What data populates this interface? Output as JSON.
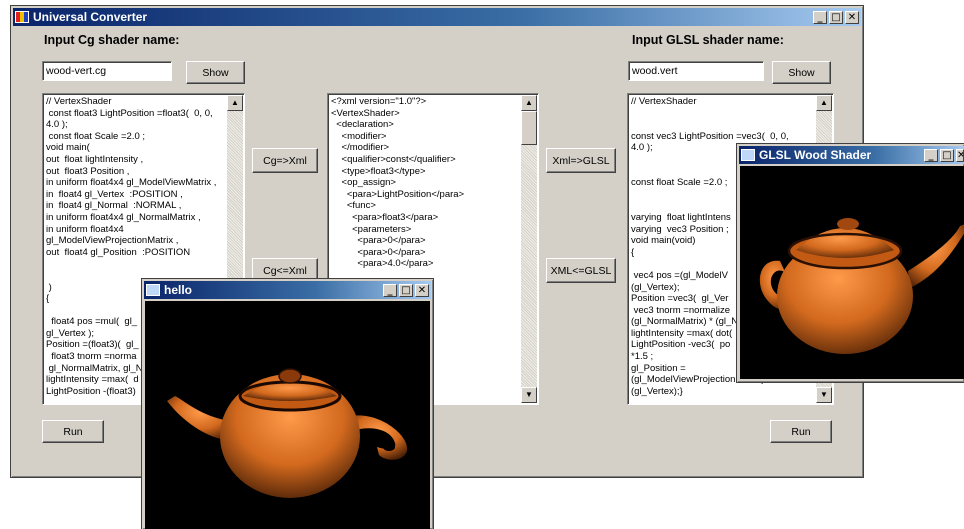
{
  "main_window": {
    "title": "Universal Converter",
    "controls": {
      "minimize": "_",
      "maximize": "□",
      "close": "✕"
    }
  },
  "cg_panel": {
    "label": "Input Cg shader name:",
    "input_value": "wood-vert.cg",
    "show_label": "Show",
    "code": "// VertexShader\n const float3 LightPosition =float3(  0, 0,\n4.0 );\n const float Scale =2.0 ;\nvoid main(\nout  float lightIntensity ,\nout  float3 Position ,\nin uniform float4x4 gl_ModelViewMatrix ,\nin  float4 gl_Vertex  :POSITION ,\nin  float4 gl_Normal  :NORMAL ,\nin uniform float4x4 gl_NormalMatrix ,\nin uniform float4x4\ngl_ModelViewProjectionMatrix ,\nout  float4 gl_Position  :POSITION\n\n\n )\n{\n\n  float4 pos =mul(  gl_\ngl_Vertex );\nPosition =(float3)(  gl_\n  float3 tnorm =norma\n gl_NormalMatrix, gl_N\nlightIntensity =max(  d\nLightPosition -(float3)",
    "run_label": "Run"
  },
  "xml_panel": {
    "code": "<?xml version=\"1.0\"?>\n<VertexShader>\n  <declaration>\n    <modifier>\n    </modifier>\n    <qualifier>const</qualifier>\n    <type>float3</type>\n    <op_assign>\n      <para>LightPosition</para>\n      <func>\n        <para>float3</para>\n        <parameters>\n          <para>0</para>\n          <para>0</para>\n          <para>4.0</para>\n\n\n\n\n\n\n\n\n                     alifier>\n\n\n                     ra>"
  },
  "convert_buttons": {
    "cg_to_xml": "Cg=>Xml",
    "xml_to_cg": "Cg<=Xml",
    "xml_to_glsl": "Xml=>GLSL",
    "glsl_to_xml": "XML<=GLSL"
  },
  "glsl_panel": {
    "label": "Input GLSL shader name:",
    "input_value": "wood.vert",
    "show_label": "Show",
    "code": "// VertexShader\n\n\nconst vec3 LightPosition =vec3(  0, 0,\n4.0 );\n\n\nconst float Scale =2.0 ;\n\n\nvarying  float lightIntens\nvarying  vec3 Position ;\nvoid main(void)\n{\n\n vec4 pos =(gl_ModelV\n(gl_Vertex);\nPosition =vec3(  gl_Ver\n vec3 tnorm =normalize\n(gl_NormalMatrix) * (gl_N\nlightIntensity =max( dot(\nLightPosition -vec3(  po\n*1.5 ;\ngl_Position =\n(gl_ModelViewProjectionMatrix)\n(gl_Vertex);}",
    "run_label": "Run"
  },
  "hello_window": {
    "title": "hello",
    "controls": {
      "minimize": "_",
      "maximize": "□",
      "close": "✕"
    }
  },
  "glsl_window": {
    "title": "GLSL Wood Shader",
    "controls": {
      "minimize": "_",
      "maximize": "□",
      "close": "✕"
    }
  },
  "colors": {
    "title_blue": "#0a246a",
    "window_face": "#d4d0c8",
    "wood_orange": "#d2691e"
  }
}
